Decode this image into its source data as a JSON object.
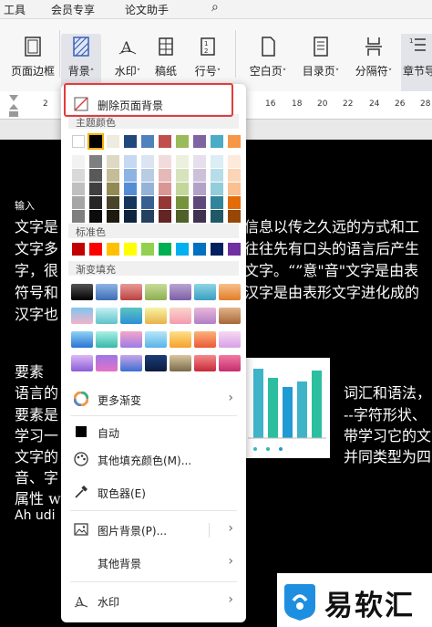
{
  "menubar": {
    "items": [
      "工具",
      "会员专享",
      "论文助手"
    ]
  },
  "ribbon": {
    "items": [
      {
        "label": "页面边框"
      },
      {
        "label": "背景",
        "caret": "˄"
      },
      {
        "label": "水印",
        "caret": "˅"
      },
      {
        "label": "稿纸"
      },
      {
        "label": "行号",
        "caret": "˅"
      },
      {
        "label": "空白页",
        "caret": "˅"
      },
      {
        "label": "目录页",
        "caret": "˅"
      },
      {
        "label": "分隔符",
        "caret": "˅"
      },
      {
        "label": "章节导"
      }
    ]
  },
  "ruler": {
    "marks": [
      "2",
      "16",
      "18",
      "20",
      "22",
      "24",
      "26",
      "28"
    ]
  },
  "document": {
    "lines": [
      "输入",
      "文字是",
      "文字多",
      "字，很",
      "符号和",
      "汉字也",
      "要素",
      "语言的",
      "要素是",
      "学习一",
      "文字的",
      "音、字",
      "属性 w",
      "Ah udi"
    ],
    "right_fragments": [
      "信息以传之久远的方式和工",
      "往往先有口头的语言后产生",
      "文字。“”意\"音\"文字是由表",
      "汉字是由表形文字进化成的",
      "词汇和语法，",
      "--字符形状、",
      "带学习它的文",
      "并同类型为四"
    ]
  },
  "popup": {
    "remove_bg": "删除页面背景",
    "theme_colors_label": "主题颜色",
    "standard_colors_label": "标准色",
    "gradient_label": "渐变填充",
    "more_gradients": "更多渐变",
    "auto": "自动",
    "other_fill": "其他填充颜色(M)...",
    "eyedropper": "取色器(E)",
    "picture_bg": "图片背景(P)...",
    "other_bg": "其他背景",
    "watermark": "水印",
    "theme_top_row": [
      "#ffffff",
      "#000000",
      "#eeece1",
      "#1f497d",
      "#4f81bd",
      "#c0504d",
      "#9bbb59",
      "#8064a2",
      "#4bacc6",
      "#f79646"
    ],
    "theme_columns": [
      [
        "#f2f2f2",
        "#d9d9d9",
        "#bfbfbf",
        "#a6a6a6",
        "#7f7f7f"
      ],
      [
        "#7f7f7f",
        "#595959",
        "#3f3f3f",
        "#262626",
        "#0c0c0c"
      ],
      [
        "#ddd9c3",
        "#c4bd97",
        "#938953",
        "#494429",
        "#1d1b10"
      ],
      [
        "#c6d9f0",
        "#8db3e2",
        "#548dd4",
        "#17365d",
        "#0f243e"
      ],
      [
        "#dbe5f1",
        "#b8cce4",
        "#95b3d7",
        "#366092",
        "#244061"
      ],
      [
        "#f2dcdb",
        "#e5b9b7",
        "#d99694",
        "#953734",
        "#632423"
      ],
      [
        "#ebf1dd",
        "#d7e3bc",
        "#c3d69b",
        "#76923c",
        "#4f6128"
      ],
      [
        "#e5e0ec",
        "#ccc1d9",
        "#b2a2c7",
        "#5f497a",
        "#3f3151"
      ],
      [
        "#dbeef3",
        "#b7dde8",
        "#92cddc",
        "#31859b",
        "#205867"
      ],
      [
        "#fdeada",
        "#fbd5b5",
        "#fac08f",
        "#e36c09",
        "#974806"
      ]
    ],
    "standard": [
      "#c00000",
      "#ff0000",
      "#ffc000",
      "#ffff00",
      "#92d050",
      "#00b050",
      "#00b0f0",
      "#0070c0",
      "#002060",
      "#7030a0"
    ],
    "gradients": [
      [
        "linear-gradient(#555,#000)",
        "linear-gradient(#8fb4e3,#3d6cb5)",
        "linear-gradient(#e89a98,#b9423f)",
        "linear-gradient(#c8dc9b,#8eae4f)",
        "linear-gradient(#b9a5d3,#7b5ea5)",
        "linear-gradient(#8ed4e6,#3a9ec0)",
        "linear-gradient(#f7c08a,#e27c28)"
      ],
      [
        "linear-gradient(#7ec6f0,#f4b3c8)",
        "linear-gradient(#c6f0f4,#5dc3c9)",
        "linear-gradient(#5dc4c0,#2c8fd6)",
        "linear-gradient(#f7f3a6,#e8b24a)",
        "linear-gradient(#f9d5c9,#f59bb0)",
        "linear-gradient(#e8b8d8,#b27ec9)",
        "linear-gradient(#e3b48a,#a8683a)"
      ],
      [
        "linear-gradient(#8fd3f5,#2b74d4)",
        "linear-gradient(#a9f0e6,#39b8a8)",
        "linear-gradient(#f6a6c9,#9c7be6)",
        "linear-gradient(#b8e6f8,#58b4e8)",
        "linear-gradient(#fde08a,#f7a12b)",
        "linear-gradient(#fbb37a,#ea5a36)",
        "linear-gradient(#f7d9f0,#d8a0e8)"
      ],
      [
        "linear-gradient(#dcb8f5,#8a5ed8)",
        "linear-gradient(#9d77e6,#e472c6)",
        "linear-gradient(#c9a4e8,#3c6fd1)",
        "linear-gradient(#1b3c7a,#0b1c3d)",
        "linear-gradient(#d8c7a0,#7a6a48)",
        "linear-gradient(#f58a8a,#c6283b)",
        "linear-gradient(#f07aa0,#c42d6f)"
      ]
    ]
  },
  "watermark_logo": {
    "text": "易软汇"
  }
}
